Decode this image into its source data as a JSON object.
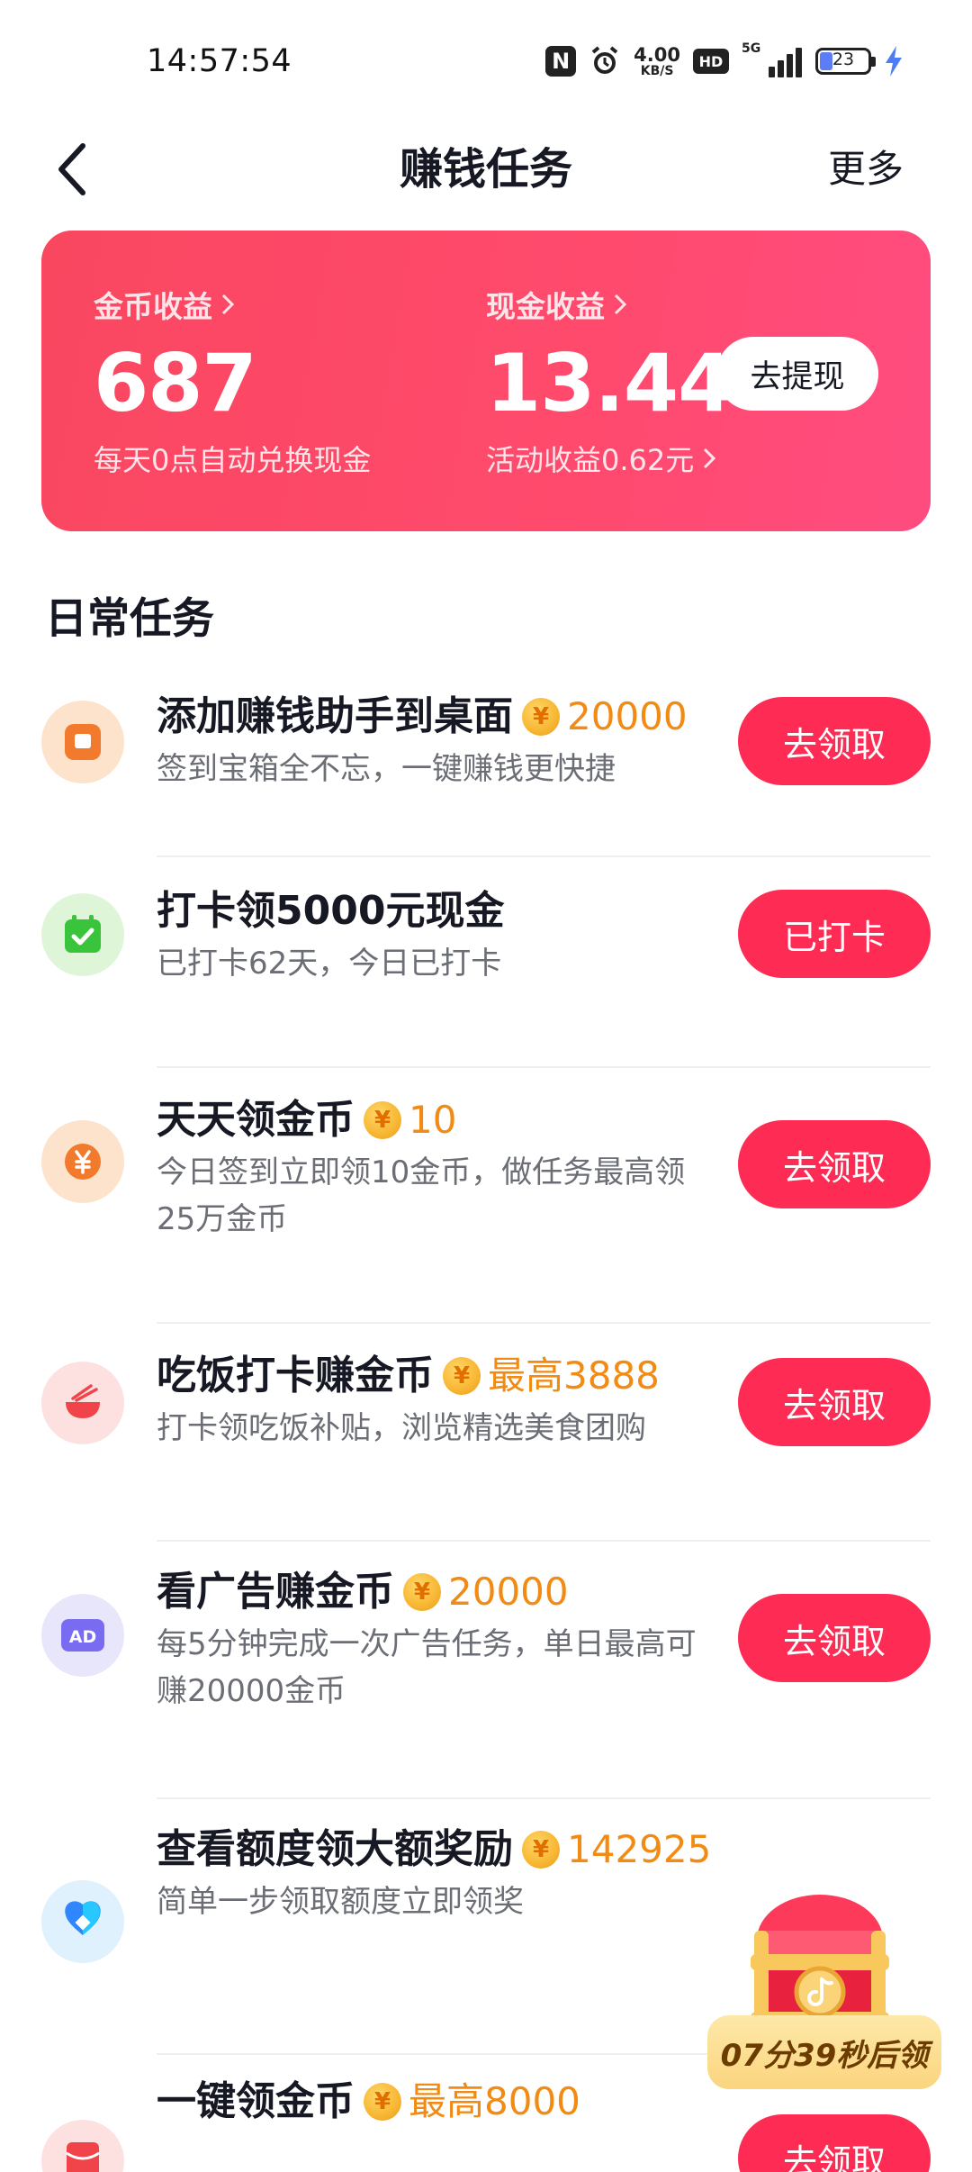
{
  "status_bar": {
    "time": "14:57:54",
    "nfc": "N",
    "net_speed_value": "4.00",
    "net_speed_unit": "KB/S",
    "hd": "HD",
    "network": "5G",
    "battery": "23"
  },
  "nav": {
    "title": "赚钱任务",
    "more": "更多"
  },
  "earnings": {
    "coin_label": "金币收益",
    "coin_value": "687",
    "coin_note": "每天0点自动兑换现金",
    "cash_label": "现金收益",
    "cash_value": "13.44",
    "cash_note": "活动收益0.62元",
    "withdraw": "去提现"
  },
  "section": {
    "title": "日常任务"
  },
  "tasks": [
    {
      "title": "添加赚钱助手到桌面",
      "reward": "20000",
      "desc": "签到宝箱全不忘，一键赚钱更快捷",
      "button": "去领取",
      "icon": "desktop-widget-icon"
    },
    {
      "title": "打卡领5000元现金",
      "reward": "",
      "desc": "已打卡62天，今日已打卡",
      "button": "已打卡",
      "icon": "calendar-check-icon"
    },
    {
      "title": "天天领金币",
      "reward": "10",
      "desc": "今日签到立即领10金币，做任务最高领25万金币",
      "button": "去领取",
      "icon": "yuan-coin-icon"
    },
    {
      "title": "吃饭打卡赚金币",
      "reward": "最高3888",
      "desc": "打卡领吃饭补贴，浏览精选美食团购",
      "button": "去领取",
      "icon": "rice-bowl-icon"
    },
    {
      "title": "看广告赚金币",
      "reward": "20000",
      "desc": "每5分钟完成一次广告任务，单日最高可赚20000金币",
      "button": "去领取",
      "icon": "ad-icon"
    },
    {
      "title": "查看额度领大额奖励",
      "reward": "142925",
      "desc": "简单一步领取额度立即领奖",
      "button": "",
      "icon": "credit-diamond-icon"
    },
    {
      "title": "一键领金币",
      "reward": "最高8000",
      "desc": "",
      "button": "去领取",
      "icon": "red-envelope-icon"
    }
  ],
  "treasure": {
    "timer": "07分39秒后领"
  },
  "colors": {
    "accent": "#fe2c55",
    "reward_orange": "#f28b14",
    "card_start": "#fa4760",
    "card_end": "#ff4c80"
  }
}
